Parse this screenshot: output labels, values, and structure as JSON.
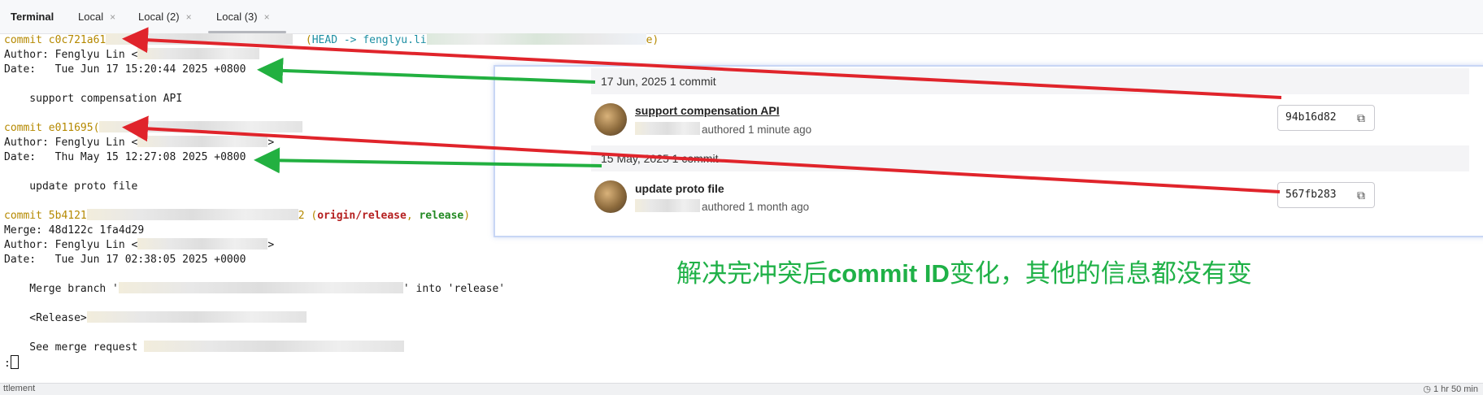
{
  "tabs": {
    "title": "Terminal",
    "items": [
      {
        "label": "Local",
        "close": "×"
      },
      {
        "label": "Local (2)",
        "close": "×"
      },
      {
        "label": "Local (3)",
        "close": "×",
        "active": true
      }
    ]
  },
  "terminal": {
    "commit1": {
      "prefix": "commit c0c721a61",
      "ref_open": "(",
      "head": "HEAD -> fenglyu.li",
      "ref_close": "e)",
      "author": "Author: Fenglyu Lin <",
      "date": "Date:   Tue Jun 17 15:20:44 2025 +0800",
      "message": "    support compensation API"
    },
    "commit2": {
      "prefix": "commit e011695(",
      "author": "Author: Fenglyu Lin <",
      "author_end": ">",
      "date": "Date:   Thu May 15 12:27:08 2025 +0800",
      "message": "    update proto file"
    },
    "commit3": {
      "prefix": "commit 5b4121",
      "ref_open": "2 (",
      "origin": "origin/release",
      "sep": ", ",
      "release": "release",
      "ref_close": ")",
      "merge": "Merge: 48d122c 1fa4d29",
      "author": "Author: Fenglyu Lin <",
      "author_end": ">",
      "date": "Date:   Tue Jun 17 02:38:05 2025 +0000",
      "msg1_start": "    Merge branch '",
      "msg1_end": "' into 'release'",
      "msg2": "    <Release>",
      "msg3": "    See merge request"
    },
    "prompt": ":"
  },
  "status_bar": {
    "left": "ttlement",
    "right": "1 hr 50 min"
  },
  "commits_panel": {
    "groups": [
      {
        "date_label": "17 Jun, 2025 1 commit",
        "title": "support compensation API",
        "meta": "authored 1 minute ago",
        "sha": "94b16d82"
      },
      {
        "date_label": "15 May, 2025 1 commit",
        "title": "update proto file",
        "meta": "authored 1 month ago",
        "sha": "567fb283"
      }
    ],
    "copy_icon": "copy-icon"
  },
  "annotation": {
    "part1": "解决完冲突后",
    "part2": "commit ID",
    "part3": "变化，其他的信息都没有变"
  },
  "colors": {
    "arrow_red": "#e0242b",
    "arrow_green": "#22b040",
    "annotation_green": "#1fb147",
    "commit_yellow": "#b58900"
  }
}
